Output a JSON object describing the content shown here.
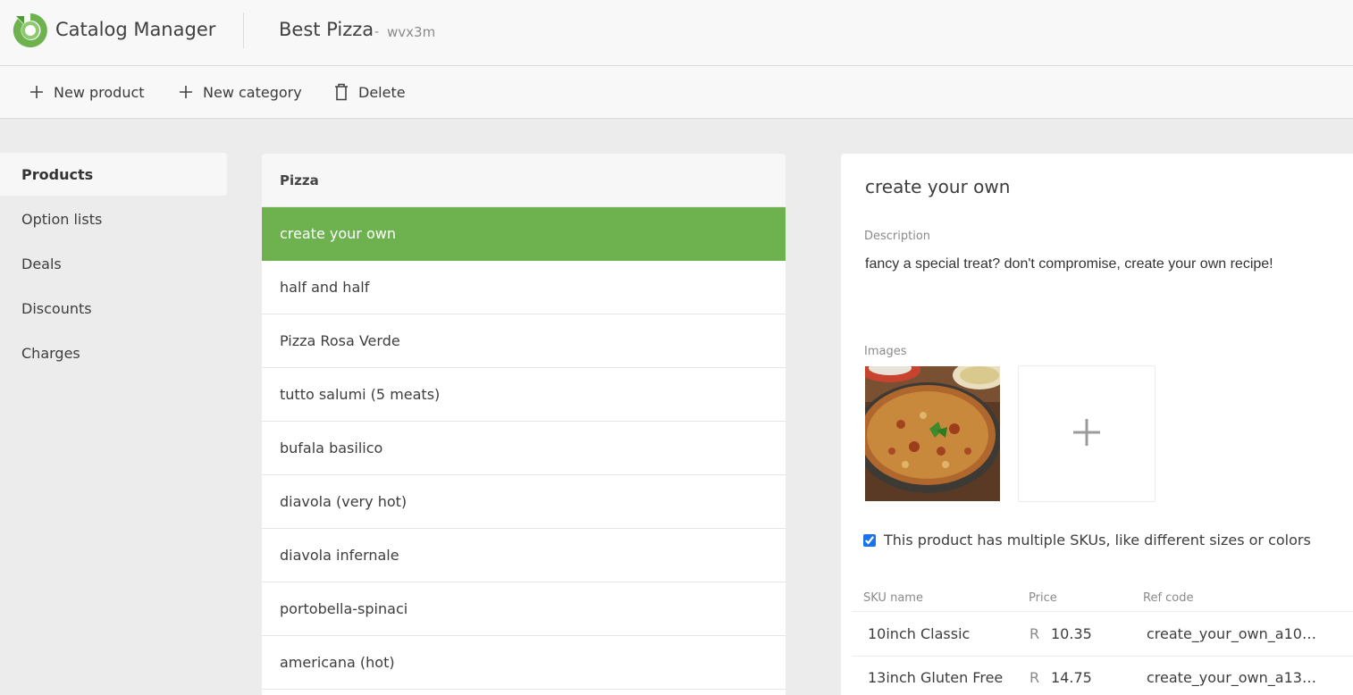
{
  "header": {
    "app_title": "Catalog Manager",
    "store_name": "Best Pizza",
    "store_separator": "-",
    "store_code": "wvx3m",
    "brand_color": "#6db24f"
  },
  "toolbar": {
    "new_product": "New product",
    "new_category": "New category",
    "delete": "Delete"
  },
  "sidebar": {
    "items": [
      {
        "label": "Products",
        "active": true
      },
      {
        "label": "Option lists"
      },
      {
        "label": "Deals"
      },
      {
        "label": "Discounts"
      },
      {
        "label": "Charges"
      }
    ]
  },
  "product_list": {
    "category": "Pizza",
    "items": [
      {
        "label": "create your own",
        "selected": true
      },
      {
        "label": "half and half"
      },
      {
        "label": "Pizza Rosa Verde"
      },
      {
        "label": "tutto salumi (5 meats)"
      },
      {
        "label": "bufala basilico"
      },
      {
        "label": "diavola (very hot)"
      },
      {
        "label": "diavola infernale"
      },
      {
        "label": "portobella-spinaci"
      },
      {
        "label": "americana (hot)"
      }
    ],
    "selected_color": "#6db24f"
  },
  "detail": {
    "title": "create your own",
    "description_label": "Description",
    "description": "fancy a special treat? don't compromise, create your own recipe!",
    "images_label": "Images",
    "add_image_icon": "plus-icon",
    "multi_sku_checked": true,
    "multi_sku_label": "This product has multiple SKUs, like different sizes or colors",
    "sku_table": {
      "headers": [
        "SKU name",
        "Price",
        "Ref code"
      ],
      "currency": "R",
      "rows": [
        {
          "name": "10inch Classic",
          "price": "10.35",
          "ref": "create_your_own_a10…"
        },
        {
          "name": "13inch Gluten Free",
          "price": "14.75",
          "ref": "create_your_own_a13…"
        }
      ]
    }
  }
}
